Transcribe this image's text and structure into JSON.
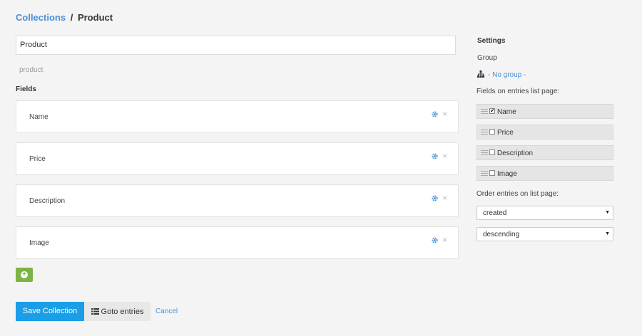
{
  "breadcrumb": {
    "parent": "Collections",
    "separator": "/",
    "current": "Product"
  },
  "collection": {
    "name_value": "Product",
    "slug": "product"
  },
  "fields": {
    "heading": "Fields",
    "items": [
      {
        "label": "Name"
      },
      {
        "label": "Price"
      },
      {
        "label": "Description"
      },
      {
        "label": "Image"
      }
    ],
    "close_glyph": "×"
  },
  "actions": {
    "save_label": "Save Collection",
    "goto_label": "Goto entries",
    "cancel_label": "Cancel"
  },
  "settings": {
    "heading": "Settings",
    "group_label": "Group",
    "group_value": "- No group -",
    "list_fields_label": "Fields on entries list page:",
    "list_fields": [
      {
        "label": "Name",
        "checked": true,
        "mark": "✔"
      },
      {
        "label": "Price",
        "checked": false,
        "mark": ""
      },
      {
        "label": "Description",
        "checked": false,
        "mark": ""
      },
      {
        "label": "Image",
        "checked": false,
        "mark": ""
      }
    ],
    "order_label": "Order entries on list page:",
    "order_by": "created",
    "order_dir": "descending",
    "arrow_glyph": "▼"
  },
  "colors": {
    "accent": "#4a90d9",
    "primary_button": "#1a9ee8",
    "add_button": "#7cb342"
  },
  "icons": [
    "gear-icon",
    "close-icon",
    "plus-icon",
    "list-icon",
    "sitemap-icon",
    "drag-handle-icon"
  ]
}
